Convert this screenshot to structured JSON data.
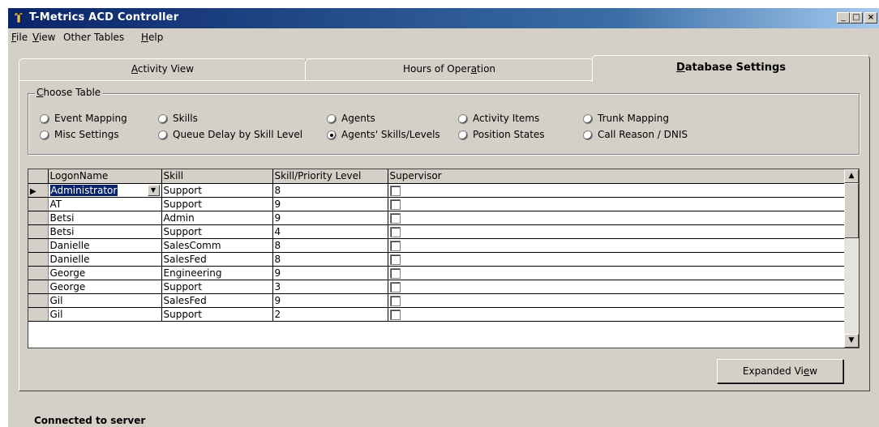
{
  "window": {
    "title": "T-Metrics ACD Controller",
    "controls": {
      "minimize": "_",
      "maximize": "□",
      "close": "×"
    }
  },
  "menu": [
    {
      "pre": "",
      "ul": "F",
      "post": "ile"
    },
    {
      "pre": "",
      "ul": "V",
      "post": "iew"
    },
    {
      "pre": "Other Tables",
      "ul": "",
      "post": ""
    },
    {
      "pre": "",
      "ul": "H",
      "post": "elp"
    }
  ],
  "tabs": [
    {
      "pre": "",
      "ul": "A",
      "post": "ctivity View"
    },
    {
      "pre": "Hours of Oper",
      "ul": "a",
      "post": "tion"
    },
    {
      "pre": "",
      "ul": "D",
      "post": "atabase Settings"
    }
  ],
  "choose_table": {
    "legend_pre": "C",
    "legend_post": "hoose Table",
    "options": [
      {
        "label": "Event Mapping",
        "selected": false
      },
      {
        "label": "Skills",
        "selected": false
      },
      {
        "label": "Agents",
        "selected": false
      },
      {
        "label": "Activity Items",
        "selected": false
      },
      {
        "label": "Trunk Mapping",
        "selected": false
      },
      {
        "label": "Misc Settings",
        "selected": false
      },
      {
        "label": "Queue Delay by Skill Level",
        "selected": false
      },
      {
        "label": "Agents' Skills/Levels",
        "selected": true
      },
      {
        "label": "Position States",
        "selected": false
      },
      {
        "label": "Call Reason / DNIS",
        "selected": false
      }
    ]
  },
  "grid": {
    "columns": [
      "LogonName",
      "Skill",
      "Skill/Priority Level",
      "Supervisor"
    ],
    "rows": [
      [
        "Administrator",
        "Support",
        "8"
      ],
      [
        "AT",
        "Support",
        "9"
      ],
      [
        "Betsi",
        "Admin",
        "9"
      ],
      [
        "Betsi",
        "Support",
        "4"
      ],
      [
        "Danielle",
        "SalesComm",
        "8"
      ],
      [
        "Danielle",
        "SalesFed",
        "8"
      ],
      [
        "George",
        "Engineering",
        "9"
      ],
      [
        "George",
        "Support",
        "3"
      ],
      [
        "Gil",
        "SalesFed",
        "9"
      ],
      [
        "Gil",
        "Support",
        "2"
      ]
    ]
  },
  "expanded_button": {
    "pre": "Expanded Vi",
    "ul": "e",
    "post": "w"
  },
  "status_text": "Connected to server"
}
